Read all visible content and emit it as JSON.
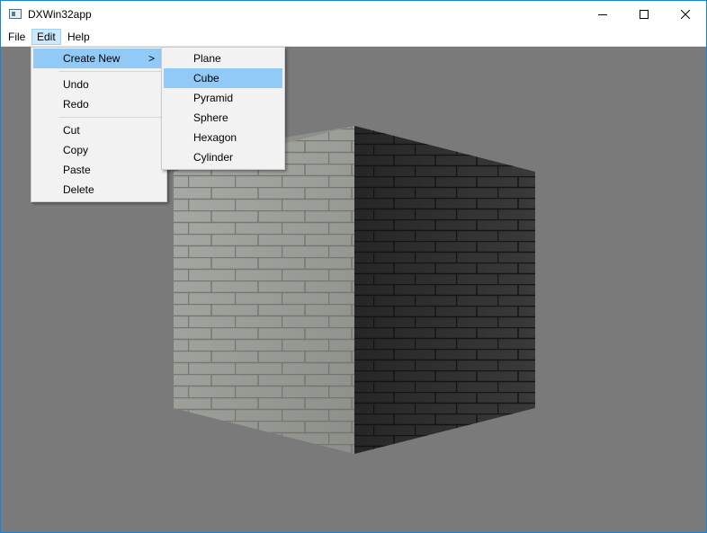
{
  "window": {
    "title": "DXWin32app",
    "controls": [
      "minimize",
      "maximize",
      "close"
    ]
  },
  "menubar": {
    "file": "File",
    "edit": "Edit",
    "help": "Help"
  },
  "edit_menu": {
    "create_new": "Create New",
    "create_new_arrow": ">",
    "undo": "Undo",
    "redo": "Redo",
    "cut": "Cut",
    "copy": "Copy",
    "paste": "Paste",
    "delete": "Delete"
  },
  "create_new_menu": {
    "plane": "Plane",
    "cube": "Cube",
    "pyramid": "Pyramid",
    "sphere": "Sphere",
    "hexagon": "Hexagon",
    "cylinder": "Cylinder",
    "highlighted": "Cube"
  },
  "scene": {
    "object": "textured-stone-brick-cube",
    "background_color": "#7a7a7a"
  },
  "colors": {
    "menu_highlight": "#91c9f7",
    "menubar_active": "#cce8ff",
    "window_border": "#1883d7"
  }
}
